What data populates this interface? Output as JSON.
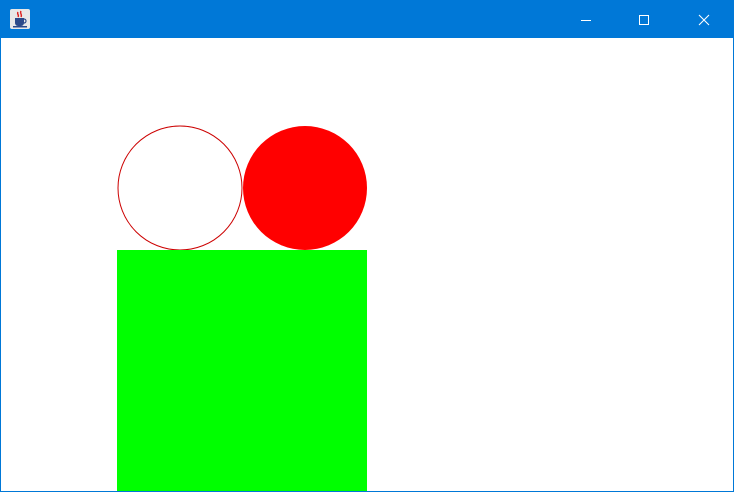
{
  "window": {
    "title": "",
    "titlebar_color": "#0078d7",
    "app_icon": "java-cup-icon",
    "controls": [
      {
        "name": "minimize-button",
        "icon": "minimize-icon"
      },
      {
        "name": "maximize-button",
        "icon": "maximize-icon"
      },
      {
        "name": "close-button",
        "icon": "close-icon"
      }
    ]
  },
  "canvas": {
    "background": "#ffffff",
    "shapes": [
      {
        "name": "outline-circle",
        "kind": "circle",
        "fill": "none",
        "stroke": "#cc0000"
      },
      {
        "name": "filled-circle",
        "kind": "circle",
        "fill": "#ff0000",
        "stroke": "none"
      },
      {
        "name": "filled-square",
        "kind": "rect",
        "fill": "#00ff00",
        "stroke": "none"
      }
    ]
  }
}
